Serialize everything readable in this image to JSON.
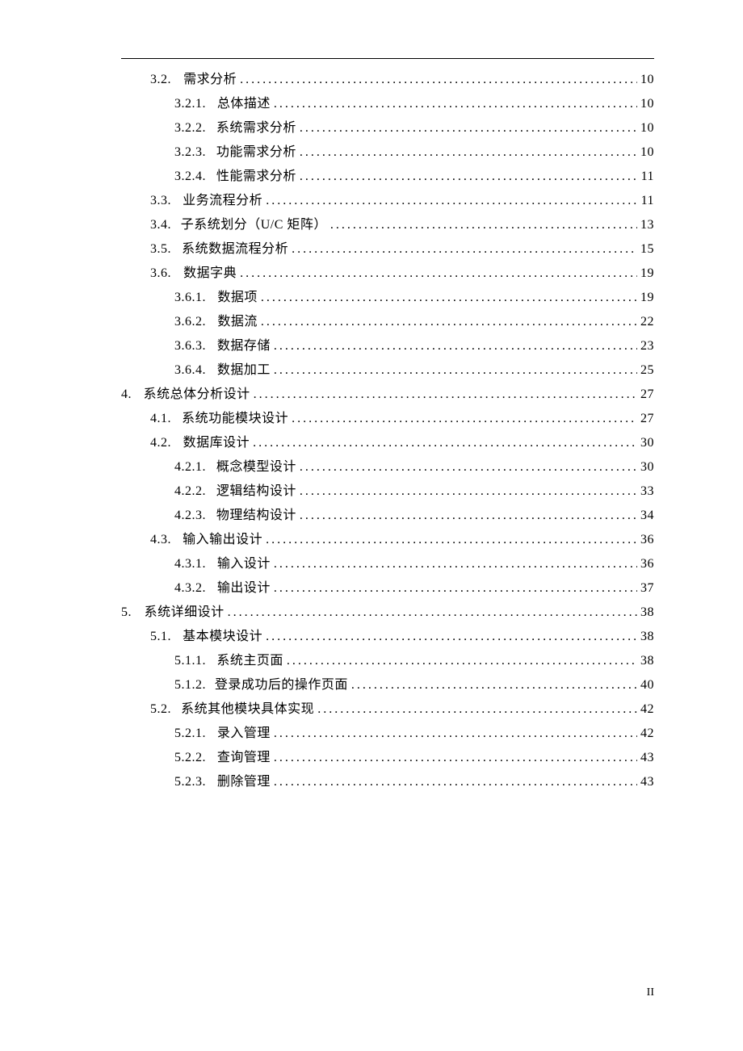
{
  "page_number_label": "II",
  "toc": [
    {
      "level": 2,
      "num": "3.2.",
      "title": "需求分析",
      "page": "10"
    },
    {
      "level": 3,
      "num": "3.2.1.",
      "title": "总体描述",
      "page": "10"
    },
    {
      "level": 3,
      "num": "3.2.2.",
      "title": "系统需求分析",
      "page": "10"
    },
    {
      "level": 3,
      "num": "3.2.3.",
      "title": "功能需求分析",
      "page": "10"
    },
    {
      "level": 3,
      "num": "3.2.4.",
      "title": "性能需求分析",
      "page": "11"
    },
    {
      "level": 2,
      "num": "3.3.",
      "title": "业务流程分析",
      "page": "11"
    },
    {
      "level": 2,
      "num": "3.4.",
      "title": "子系统划分（U/C 矩阵）",
      "page": "13"
    },
    {
      "level": 2,
      "num": "3.5.",
      "title": "系统数据流程分析",
      "page": "15"
    },
    {
      "level": 2,
      "num": "3.6.",
      "title": "数据字典",
      "page": "19"
    },
    {
      "level": 3,
      "num": "3.6.1.",
      "title": "数据项",
      "page": "19"
    },
    {
      "level": 3,
      "num": "3.6.2.",
      "title": "数据流",
      "page": "22"
    },
    {
      "level": 3,
      "num": "3.6.3.",
      "title": "数据存储",
      "page": "23"
    },
    {
      "level": 3,
      "num": "3.6.4.",
      "title": "数据加工",
      "page": "25"
    },
    {
      "level": 1,
      "num": "4.",
      "title": "系统总体分析设计",
      "page": "27"
    },
    {
      "level": 2,
      "num": "4.1.",
      "title": "系统功能模块设计",
      "page": "27"
    },
    {
      "level": 2,
      "num": "4.2.",
      "title": "数据库设计",
      "page": "30"
    },
    {
      "level": 3,
      "num": "4.2.1.",
      "title": "概念模型设计",
      "page": "30"
    },
    {
      "level": 3,
      "num": "4.2.2.",
      "title": "逻辑结构设计",
      "page": "33"
    },
    {
      "level": 3,
      "num": "4.2.3.",
      "title": "物理结构设计",
      "page": "34"
    },
    {
      "level": 2,
      "num": "4.3.",
      "title": "输入输出设计",
      "page": "36"
    },
    {
      "level": 3,
      "num": "4.3.1.",
      "title": "输入设计",
      "page": "36"
    },
    {
      "level": 3,
      "num": "4.3.2.",
      "title": "输出设计",
      "page": "37"
    },
    {
      "level": 1,
      "num": "5.",
      "title": "系统详细设计",
      "page": "38"
    },
    {
      "level": 2,
      "num": "5.1.",
      "title": "基本模块设计",
      "page": "38"
    },
    {
      "level": 3,
      "num": "5.1.1.",
      "title": "系统主页面",
      "page": "38"
    },
    {
      "level": 3,
      "num": "5.1.2.",
      "title": "登录成功后的操作页面",
      "page": "40"
    },
    {
      "level": 2,
      "num": "5.2.",
      "title": "系统其他模块具体实现",
      "page": "42"
    },
    {
      "level": 3,
      "num": "5.2.1.",
      "title": "录入管理",
      "page": "42"
    },
    {
      "level": 3,
      "num": "5.2.2.",
      "title": "查询管理",
      "page": "43"
    },
    {
      "level": 3,
      "num": "5.2.3.",
      "title": "删除管理",
      "page": "43"
    }
  ]
}
